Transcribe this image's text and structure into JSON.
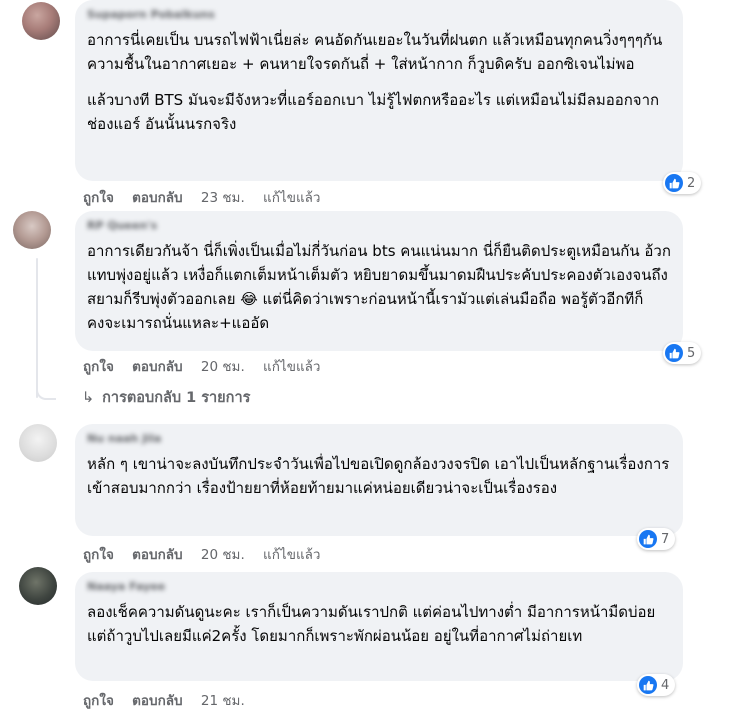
{
  "comments": [
    {
      "author": "Supaporn Pobalkuns",
      "paragraphs": [
        "อาการนี่เคยเป็น บนรถไฟฟ้าเนี่ยล่ะ คนอัดกันเยอะในวันที่ฝนตก แล้วเหมือนทุกคนวิ่งๆๆๆกัน ความชื้นในอากาศเยอะ + คนหายใจรดกันถี่ + ใส่หน้ากาก ก็วูบดิครับ ออกซิเจนไม่พอ",
        "แล้วบางที BTS มันจะมีจังหวะที่แอร์ออกเบา ไม่รู้ไฟตกหรืออะไร แต่เหมือนไม่มีลมออกจากช่องแอร์ อันนั้นนรกจริง"
      ],
      "like": "ถูกใจ",
      "reply": "ตอบกลับ",
      "time": "23 ชม.",
      "edited": "แก้ไขแล้ว",
      "reactions": "2"
    },
    {
      "author": "RP Queen's",
      "paragraphs": [
        "อาการเดียวกันจ้า นี่ก็เพิ่งเป็นเมื่อไม่กี่วันก่อน bts คนแน่นมาก นี่ก็ยืนติดประตูเหมือนกัน อ้วกแทบพุ่งอยู่แล้ว เหงื่อก็แตกเต็มหน้าเต็มตัว หยิบยาดมขึ้นมาดมฝืนประคับประคองตัวเองจนถึงสยามก็รีบพุ่งตัวออกเลย 😂 แต่นี่คิดว่าเพราะก่อนหน้านี้เรามัวแต่เล่นมือถือ พอรู้ตัวอีกทีก็คงจะเมารถนั่นแหละ+แออัด"
      ],
      "like": "ถูกใจ",
      "reply": "ตอบกลับ",
      "time": "20 ชม.",
      "edited": "แก้ไขแล้ว",
      "reactions": "5",
      "replies_link": "การตอบกลับ 1 รายการ"
    },
    {
      "author": "Nu naah Jila",
      "paragraphs": [
        "หลัก ๆ เขาน่าจะลงบันทึกประจำวันเพื่อไปขอเปิดดูกล้องวงจรปิด เอาไปเป็นหลักฐานเรื่องการเข้าสอบมากกว่า เรื่องป้ายยาที่ห้อยท้ายมาแค่หน่อยเดียวน่าจะเป็นเรื่องรอง"
      ],
      "like": "ถูกใจ",
      "reply": "ตอบกลับ",
      "time": "20 ชม.",
      "edited": "แก้ไขแล้ว",
      "reactions": "7"
    },
    {
      "author": "Naaya Fayee",
      "paragraphs": [
        "ลองเช็คความดันดูนะคะ เราก็เป็นความดันเราปกติ แต่ค่อนไปทางต่ำ มีอาการหน้ามืดบ่อย แต่ถ้าวูบไปเลยมีแค่2ครั้ง โดยมากก็เพราะพักผ่อนน้อย อยู่ในที่อากาศไม่ถ่ายเท"
      ],
      "like": "ถูกใจ",
      "reply": "ตอบกลับ",
      "time": "21 ชม.",
      "edited": "",
      "reactions": "4"
    }
  ],
  "colors": {
    "bubble": "#f0f2f5",
    "meta": "#65676b",
    "like": "#1877f2"
  },
  "icons": {
    "like": "thumbs-up-icon",
    "reply_arrow": "reply-arrow-icon"
  }
}
